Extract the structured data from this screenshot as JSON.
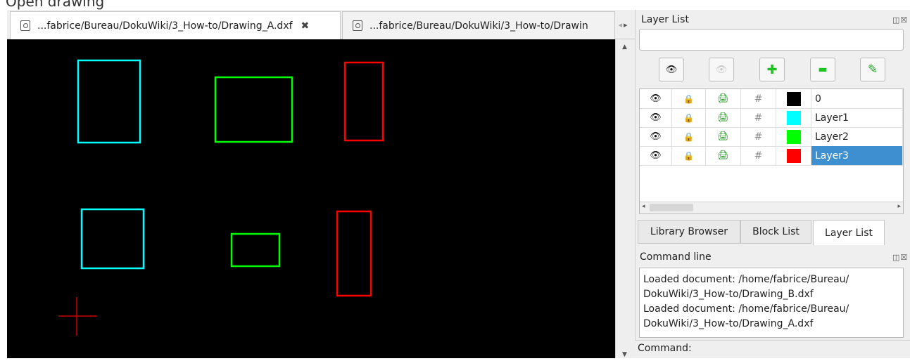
{
  "page_top_text": "Open drawing",
  "tabs": [
    {
      "label": "...fabrice/Bureau/DokuWiki/3_How-to/Drawing_A.dxf",
      "close": "✖",
      "active": true
    },
    {
      "label": "...fabrice/Bureau/DokuWiki/3_How-to/Drawin",
      "active": false
    }
  ],
  "tab_scroll": {
    "left": "◂",
    "right": "▸"
  },
  "canvas": {
    "background": "#000000",
    "shapes": [
      {
        "kind": "rectangle",
        "layer": "Layer1",
        "color": "#00ffff"
      },
      {
        "kind": "rectangle",
        "layer": "Layer2",
        "color": "#00ff00"
      },
      {
        "kind": "rectangle",
        "layer": "Layer3",
        "color": "#ff0000"
      },
      {
        "kind": "rectangle",
        "layer": "Layer1",
        "color": "#00ffff"
      },
      {
        "kind": "rectangle",
        "layer": "Layer2",
        "color": "#00ff00"
      },
      {
        "kind": "rectangle",
        "layer": "Layer3",
        "color": "#ff0000"
      }
    ],
    "crosshair_color": "#cc0000"
  },
  "layer_list": {
    "title": "Layer List",
    "dock_buttons": "◫☒",
    "search_value": "",
    "toolbar": [
      {
        "name": "show-all-layers-button",
        "icon": "eye-icon",
        "glyph": "👁"
      },
      {
        "name": "hide-all-layers-button",
        "icon": "eye-hidden-icon",
        "glyph": "👁"
      },
      {
        "name": "add-layer-button",
        "icon": "plus-icon",
        "glyph": "✚"
      },
      {
        "name": "remove-layer-button",
        "icon": "minus-icon",
        "glyph": "▬"
      },
      {
        "name": "edit-layer-button",
        "icon": "pencil-icon",
        "glyph": "✎"
      }
    ],
    "layers": [
      {
        "name": "0",
        "color": "#000000",
        "selected": false
      },
      {
        "name": "Layer1",
        "color": "#00ffff",
        "selected": false
      },
      {
        "name": "Layer2",
        "color": "#00ff00",
        "selected": false
      },
      {
        "name": "Layer3",
        "color": "#ff0000",
        "selected": true
      }
    ],
    "glyphs": {
      "eye": "👁",
      "lock": "🔒",
      "print": "🖨",
      "grid": "#"
    }
  },
  "dock_tabs": [
    {
      "label": "Library Browser",
      "active": false
    },
    {
      "label": "Block List",
      "active": false
    },
    {
      "label": "Layer List",
      "active": true
    }
  ],
  "command_line": {
    "title": "Command line",
    "dock_buttons": "◫☒",
    "output": [
      "Loaded document: /home/fabrice/Bureau/",
      "DokuWiki/3_How-to/Drawing_B.dxf",
      "Loaded document: /home/fabrice/Bureau/",
      "DokuWiki/3_How-to/Drawing_A.dxf"
    ],
    "prompt_label": "Command:"
  },
  "selection_color": "#3d8fd0"
}
